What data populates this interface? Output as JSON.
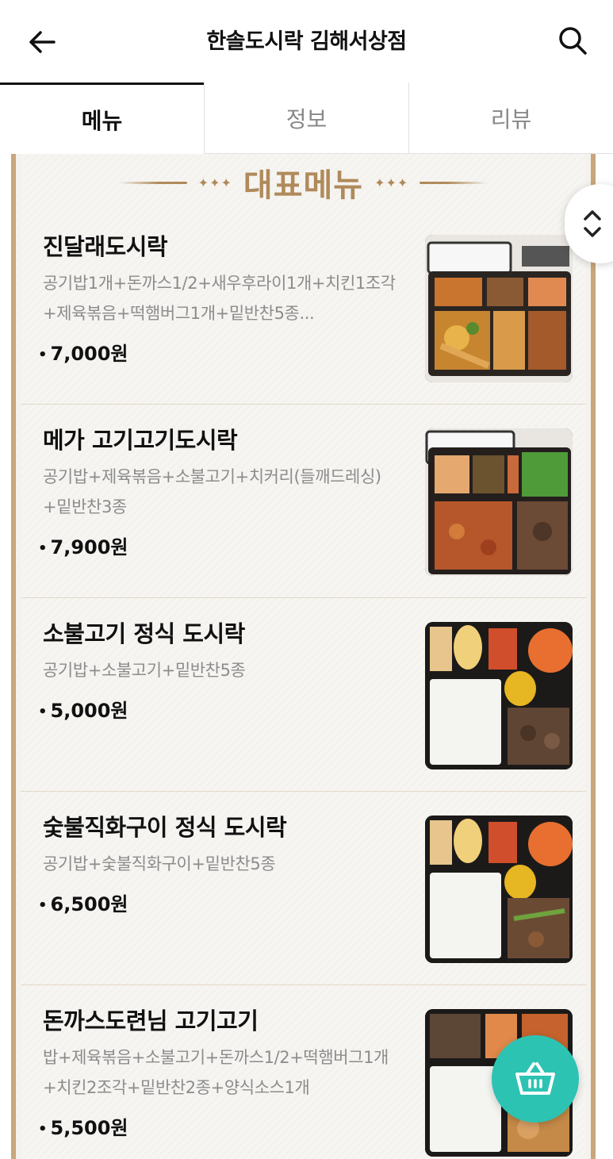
{
  "header": {
    "title": "한솔도시락 김해서상점",
    "back_icon": "arrow-left-icon",
    "search_icon": "search-icon"
  },
  "tabs": [
    {
      "label": "메뉴",
      "active": true
    },
    {
      "label": "정보",
      "active": false
    },
    {
      "label": "리뷰",
      "active": false
    }
  ],
  "section": {
    "title": "대표메뉴",
    "ornament": "✦✦✦"
  },
  "menu_items": [
    {
      "name": "진달래도시락",
      "desc": "공기밥1개+돈까스1/2+새우후라이1개+치킨1조각+제육볶음+떡햄버그1개+밑반찬5종...",
      "price": "7,000원"
    },
    {
      "name": "메가 고기고기도시락",
      "desc": "공기밥+제육볶음+소불고기+치커리(들깨드레싱)+밑반찬3종",
      "price": "7,900원"
    },
    {
      "name": "소불고기 정식 도시락",
      "desc": "공기밥+소불고기+밑반찬5종",
      "price": "5,000원"
    },
    {
      "name": "숯불직화구이 정식 도시락",
      "desc": "공기밥+숯불직화구이+밑반찬5종",
      "price": "6,500원"
    },
    {
      "name": "돈까스도련님 고기고기",
      "desc": "밥+제육볶음+소불고기+돈까스1/2+떡햄버그1개+치킨2조각+밑반찬2종+양식소스1개",
      "price": "5,500원"
    }
  ],
  "price_bullet": "•",
  "fab": {
    "scroll_icon": "chevron-up-down-icon",
    "cart_icon": "basket-icon"
  },
  "colors": {
    "accent_gold": "#b08a5a",
    "cart_teal": "#2cc3b3"
  }
}
